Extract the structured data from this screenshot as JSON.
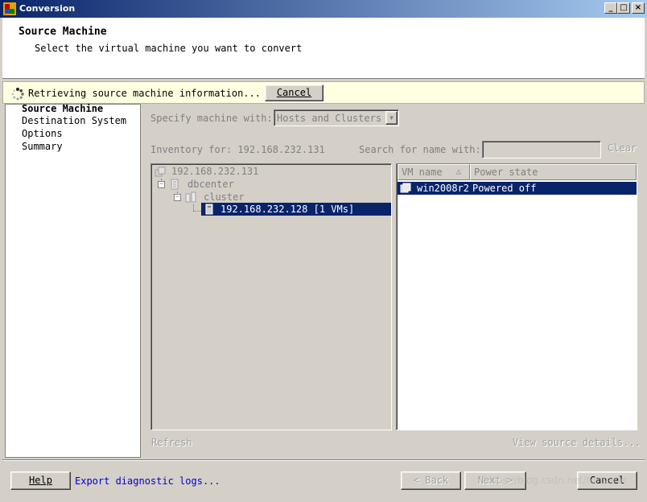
{
  "window": {
    "title": "Conversion",
    "controls": [
      "_",
      "□",
      "×"
    ]
  },
  "header": {
    "title": "Source Machine",
    "subtitle": "Select the virtual machine you want to convert"
  },
  "status": {
    "text": "Retrieving source machine information...",
    "cancel_label": "Cancel"
  },
  "nav": {
    "items": [
      "Source Machine",
      "Destination System",
      "Options",
      "Summary"
    ]
  },
  "specify": {
    "label": "Specify machine with:",
    "value": "Hosts and Clusters"
  },
  "inventory": {
    "label": "Inventory for: 192.168.232.131"
  },
  "search": {
    "label": "Search for name with:",
    "value": "",
    "clear_label": "Clear"
  },
  "tree": {
    "root": "192.168.232.131",
    "datacenter": "dbcenter",
    "cluster": "cluster",
    "host": "192.168.232.128 [1 VMs]"
  },
  "vmtable": {
    "columns": [
      "VM name",
      "Power state"
    ],
    "rows": [
      {
        "name": "win2008r2",
        "state": "Powered off"
      }
    ]
  },
  "actions": {
    "refresh": "Refresh",
    "view_details": "View source details..."
  },
  "footer": {
    "help": "Help",
    "export": "Export diagnostic logs...",
    "back": "< Back",
    "next": "Next >",
    "cancel": "Cancel",
    "watermark": "https://blog.csdn.net/tonsarar"
  }
}
